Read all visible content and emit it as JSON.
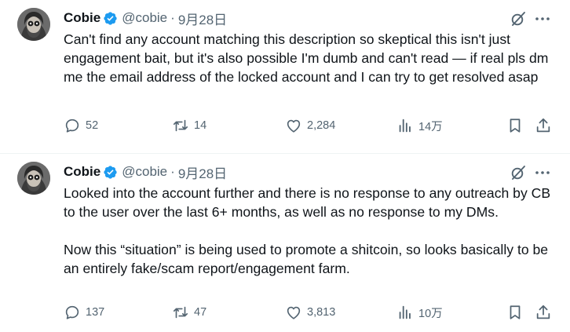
{
  "tweets": [
    {
      "author_name": "Cobie",
      "handle": "@cobie",
      "separator": "·",
      "date": "9月28日",
      "text": "Can't find any account matching this description so skeptical this isn't just engagement bait, but it's also possible I'm dumb and can't read — if real pls dm me the email address of the locked account and I can try to get resolved asap",
      "replies": "52",
      "retweets": "14",
      "likes": "2,284",
      "views": "14万"
    },
    {
      "author_name": "Cobie",
      "handle": "@cobie",
      "separator": "·",
      "date": "9月28日",
      "text": "Looked into the account further and there is no response to any outreach by CB to the user over the last 6+ months, as well as no response to my DMs.\n\nNow this “situation” is being used to promote a shitcoin, so looks basically to be an entirely fake/scam report/engagement farm.",
      "replies": "137",
      "retweets": "47",
      "likes": "3,813",
      "views": "10万"
    }
  ],
  "colors": {
    "text": "#0f1419",
    "secondary": "#536471",
    "verified": "#1d9bf0",
    "divider": "#eff3f4"
  },
  "icons": [
    "avatar",
    "verified-badge-icon",
    "grok-icon",
    "more-icon",
    "reply-icon",
    "retweet-icon",
    "like-icon",
    "views-icon",
    "bookmark-icon",
    "share-icon"
  ]
}
